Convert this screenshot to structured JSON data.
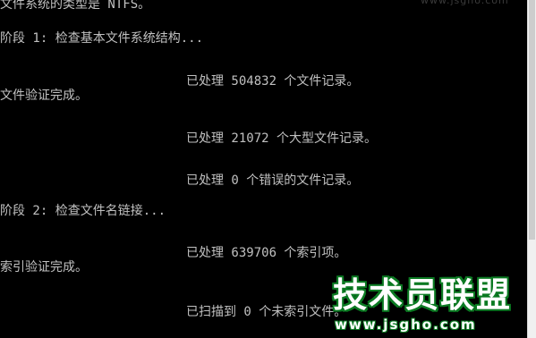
{
  "console": {
    "lines": [
      "文件系统的类型是 NTFS。",
      "阶段 1: 检查基本文件系统结构...",
      "已处理 504832 个文件记录。",
      "文件验证完成。",
      "已处理 21072 个大型文件记录。",
      "已处理 0 个错误的文件记录。",
      "阶段 2: 检查文件名链接...",
      "已处理 639706 个索引项。",
      "索引验证完成。",
      "已扫描到 0 个未索引文件。"
    ]
  },
  "watermark": {
    "title": "技术员联盟",
    "url": "www.jsgho.com",
    "top_text": "www.jsgho.com"
  },
  "colors": {
    "background": "#000000",
    "text": "#c0c0c0",
    "watermark_green": "#0b7a22"
  }
}
